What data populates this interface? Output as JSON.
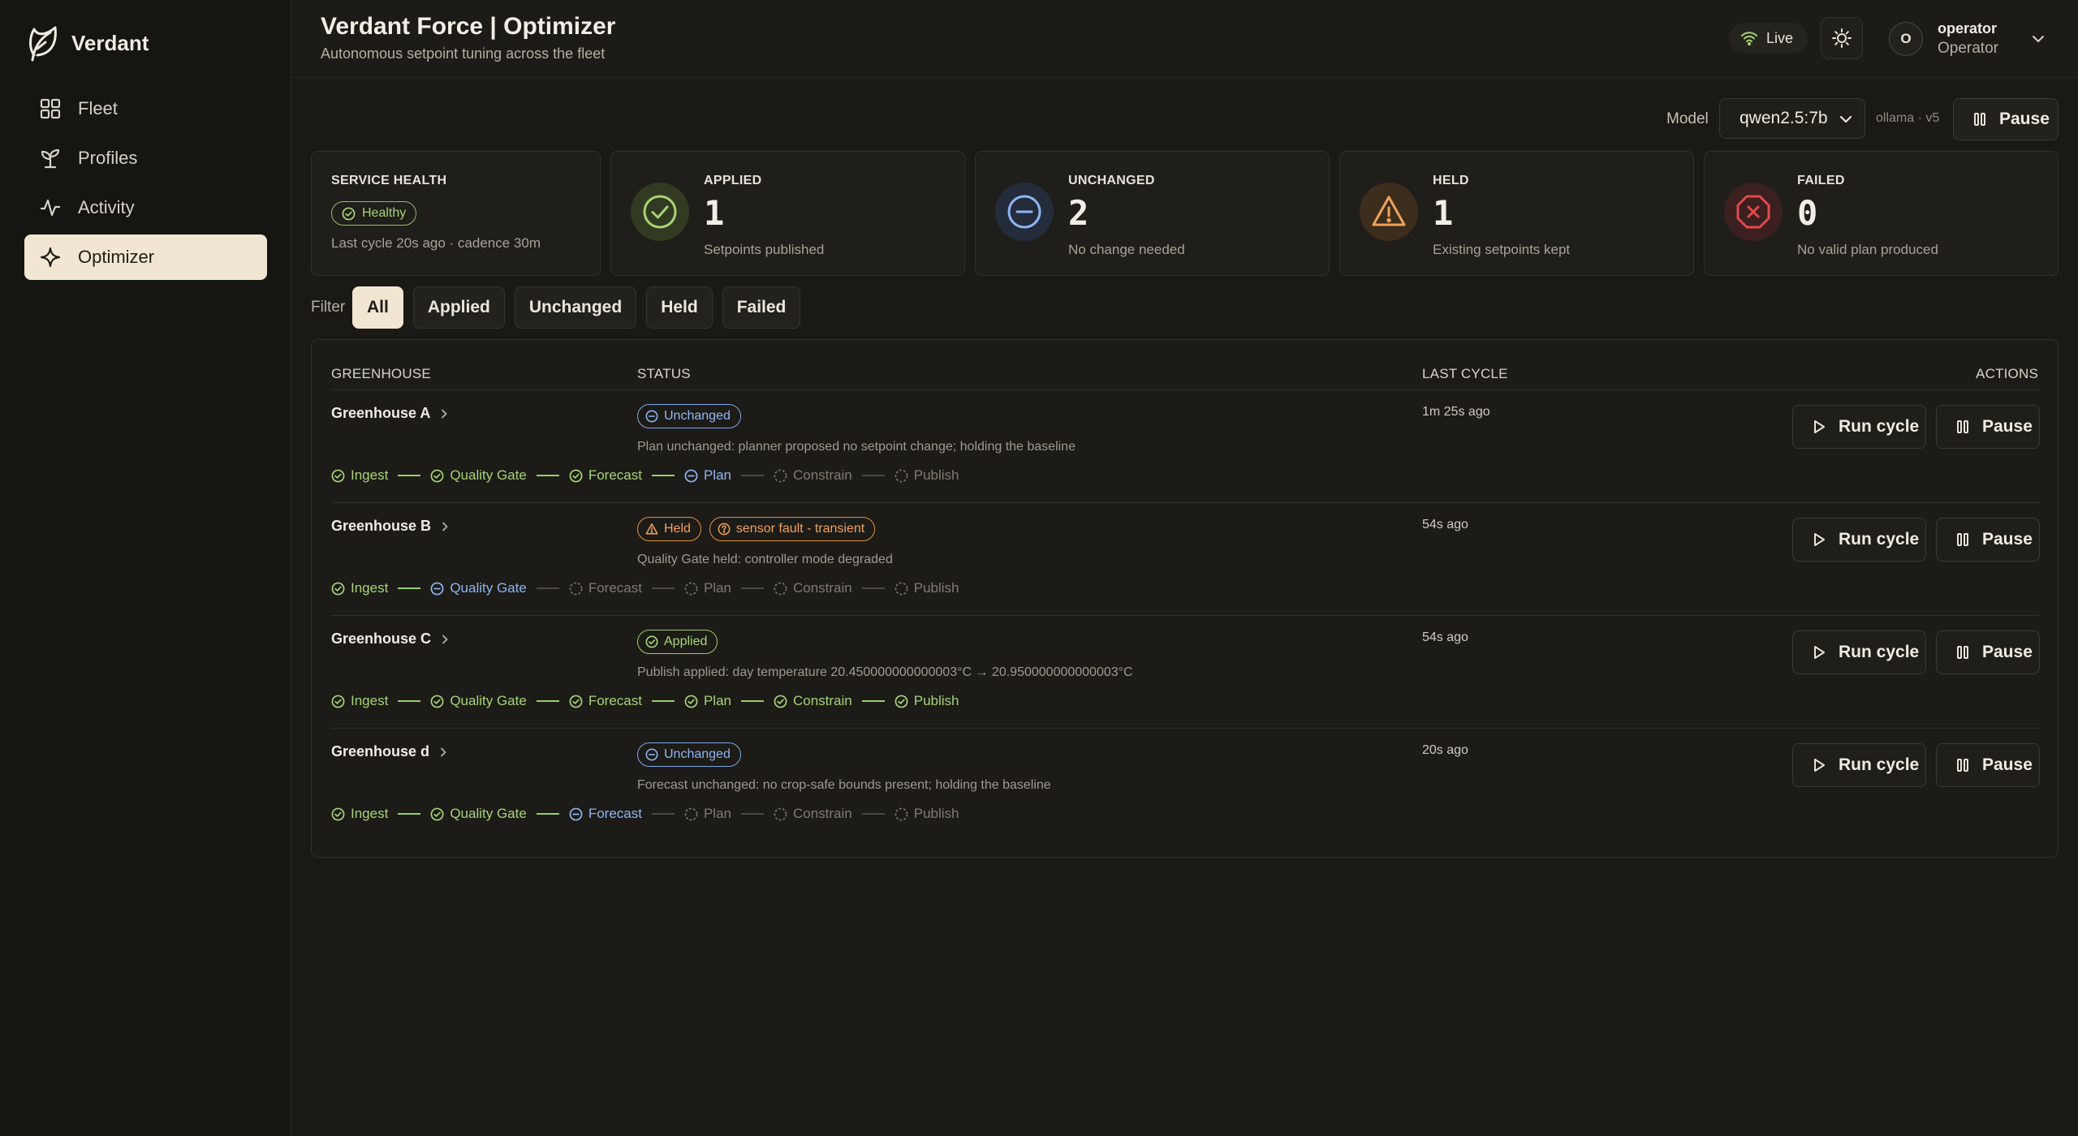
{
  "brand": {
    "name": "Verdant"
  },
  "sidebar": {
    "items": [
      {
        "label": "Fleet",
        "icon": "grid-icon",
        "active": false
      },
      {
        "label": "Profiles",
        "icon": "sprout-icon",
        "active": false
      },
      {
        "label": "Activity",
        "icon": "activity-icon",
        "active": false
      },
      {
        "label": "Optimizer",
        "icon": "sparkle-icon",
        "active": true
      }
    ]
  },
  "header": {
    "title": "Verdant Force | Optimizer",
    "subtitle": "Autonomous setpoint tuning across the fleet",
    "live_label": "Live",
    "user": {
      "initial": "O",
      "name": "operator",
      "role": "Operator"
    }
  },
  "toolbar": {
    "model_label": "Model",
    "model_value": "qwen2.5:7b",
    "model_meta": "ollama · v5",
    "pause_label": "Pause"
  },
  "stats": {
    "health": {
      "label": "SERVICE HEALTH",
      "status": "Healthy",
      "desc": "Last cycle 20s ago · cadence 30m"
    },
    "applied": {
      "label": "APPLIED",
      "value": "1",
      "desc": "Setpoints published"
    },
    "unchanged": {
      "label": "UNCHANGED",
      "value": "2",
      "desc": "No change needed"
    },
    "held": {
      "label": "HELD",
      "value": "1",
      "desc": "Existing setpoints kept"
    },
    "failed": {
      "label": "FAILED",
      "value": "0",
      "desc": "No valid plan produced"
    }
  },
  "filter": {
    "label": "Filter",
    "options": [
      "All",
      "Applied",
      "Unchanged",
      "Held",
      "Failed"
    ],
    "selected": "All"
  },
  "table": {
    "headers": {
      "greenhouse": "GREENHOUSE",
      "status": "STATUS",
      "last_cycle": "LAST CYCLE",
      "actions": "ACTIONS"
    },
    "run_label": "Run cycle",
    "pause_label": "Pause",
    "stage_names": [
      "Ingest",
      "Quality Gate",
      "Forecast",
      "Plan",
      "Constrain",
      "Publish"
    ],
    "rows": [
      {
        "name": "Greenhouse A",
        "badges": [
          {
            "text": "Unchanged",
            "kind": "unchanged"
          }
        ],
        "note": "Plan unchanged: planner proposed no setpoint change; holding the baseline",
        "last": "1m 25s ago",
        "stages": [
          "done",
          "done",
          "done",
          "current",
          "pending",
          "pending"
        ]
      },
      {
        "name": "Greenhouse B",
        "badges": [
          {
            "text": "Held",
            "kind": "held"
          },
          {
            "text": "sensor fault - transient",
            "kind": "fault"
          }
        ],
        "note": "Quality Gate held: controller mode degraded",
        "last": "54s ago",
        "stages": [
          "done",
          "current",
          "pending",
          "pending",
          "pending",
          "pending"
        ]
      },
      {
        "name": "Greenhouse C",
        "badges": [
          {
            "text": "Applied",
            "kind": "applied"
          }
        ],
        "note": "Publish applied: day temperature 20.450000000000003°C → 20.950000000000003°C",
        "last": "54s ago",
        "stages": [
          "done",
          "done",
          "done",
          "done",
          "done",
          "done"
        ]
      },
      {
        "name": "Greenhouse d",
        "badges": [
          {
            "text": "Unchanged",
            "kind": "unchanged"
          }
        ],
        "note": "Forecast unchanged: no crop-safe bounds present; holding the baseline",
        "last": "20s ago",
        "stages": [
          "done",
          "done",
          "current",
          "pending",
          "pending",
          "pending"
        ]
      }
    ]
  },
  "colors": {
    "accent_green": "#a6d476",
    "accent_blue": "#8fb5f2",
    "accent_orange": "#f0a25a",
    "accent_red": "#e5484d",
    "active_nav": "#f1e6d2"
  }
}
